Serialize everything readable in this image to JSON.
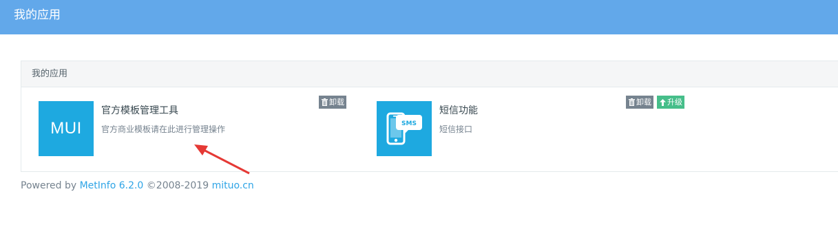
{
  "header": {
    "title": "我的应用"
  },
  "panel": {
    "title": "我的应用",
    "apps": [
      {
        "name": "官方模板管理工具",
        "description": "官方商业模板请在此进行管理操作",
        "icon": "mui-logo-icon",
        "icon_text": "MUI",
        "actions": [
          {
            "label": "卸载",
            "icon": "trash-icon"
          }
        ]
      },
      {
        "name": "短信功能",
        "description": "短信接口",
        "icon": "sms-phone-icon",
        "icon_text": "SMS",
        "actions": [
          {
            "label": "卸载",
            "icon": "trash-icon"
          },
          {
            "label": "升级",
            "icon": "arrow-up-icon"
          }
        ]
      }
    ]
  },
  "footer": {
    "powered_by": "Powered by ",
    "product_link": "MetInfo 6.2.0",
    "copyright": " ©2008-2019 ",
    "site_link": "mituo.cn"
  },
  "colors": {
    "header_bg": "#62a8ea",
    "icon_bg": "#1ea9e0",
    "uninstall_badge": "#76838f",
    "upgrade_badge": "#46be8a",
    "link": "#2ea4e6",
    "annotation_arrow": "#e53935"
  }
}
